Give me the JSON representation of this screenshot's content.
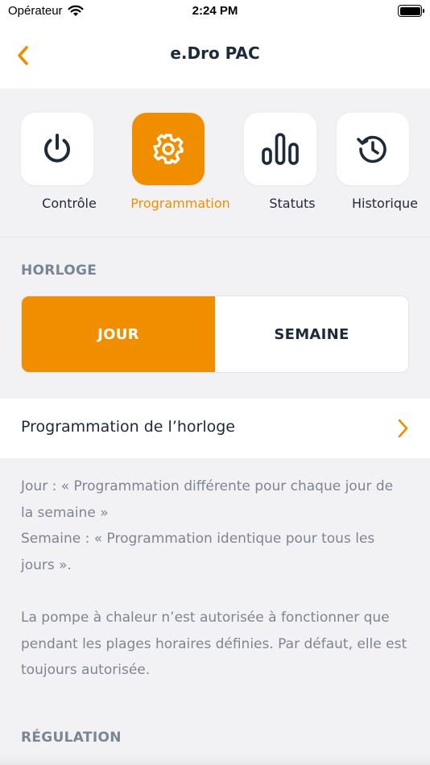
{
  "status_bar": {
    "carrier": "Opérateur",
    "time": "2:24 PM",
    "wifi_icon": "wifi-icon",
    "battery_icon": "battery-full-icon"
  },
  "header": {
    "title": "e.Dro PAC",
    "back_icon": "chevron-left-icon"
  },
  "colors": {
    "accent": "#f18e00",
    "text_dark": "#1c2a3a",
    "text_muted": "#7b8694",
    "background": "#f2f2f4"
  },
  "tabs": [
    {
      "label": "Contrôle",
      "icon": "power-icon",
      "active": false
    },
    {
      "label": "Programmation",
      "icon": "gear-icon",
      "active": true
    },
    {
      "label": "Statuts",
      "icon": "bar-chart-icon",
      "active": false
    },
    {
      "label": "Historique",
      "icon": "history-icon",
      "active": false
    }
  ],
  "clock_section": {
    "label": "HORLOGE",
    "options": [
      {
        "label": "JOUR",
        "selected": true
      },
      {
        "label": "SEMAINE",
        "selected": false
      }
    ]
  },
  "schedule_row": {
    "label": "Programmation de l’horloge",
    "chevron_icon": "chevron-right-icon"
  },
  "info": {
    "line1": "Jour : « Programmation différente pour chaque jour de la semaine »",
    "line2": "Semaine : « Programmation identique pour tous les jours ».",
    "line3": "La pompe à chaleur n’est autorisée à fonctionner que pendant les plages horaires définies. Par défaut, elle est toujours autorisée."
  },
  "regulation_section": {
    "label": "RÉGULATION"
  }
}
